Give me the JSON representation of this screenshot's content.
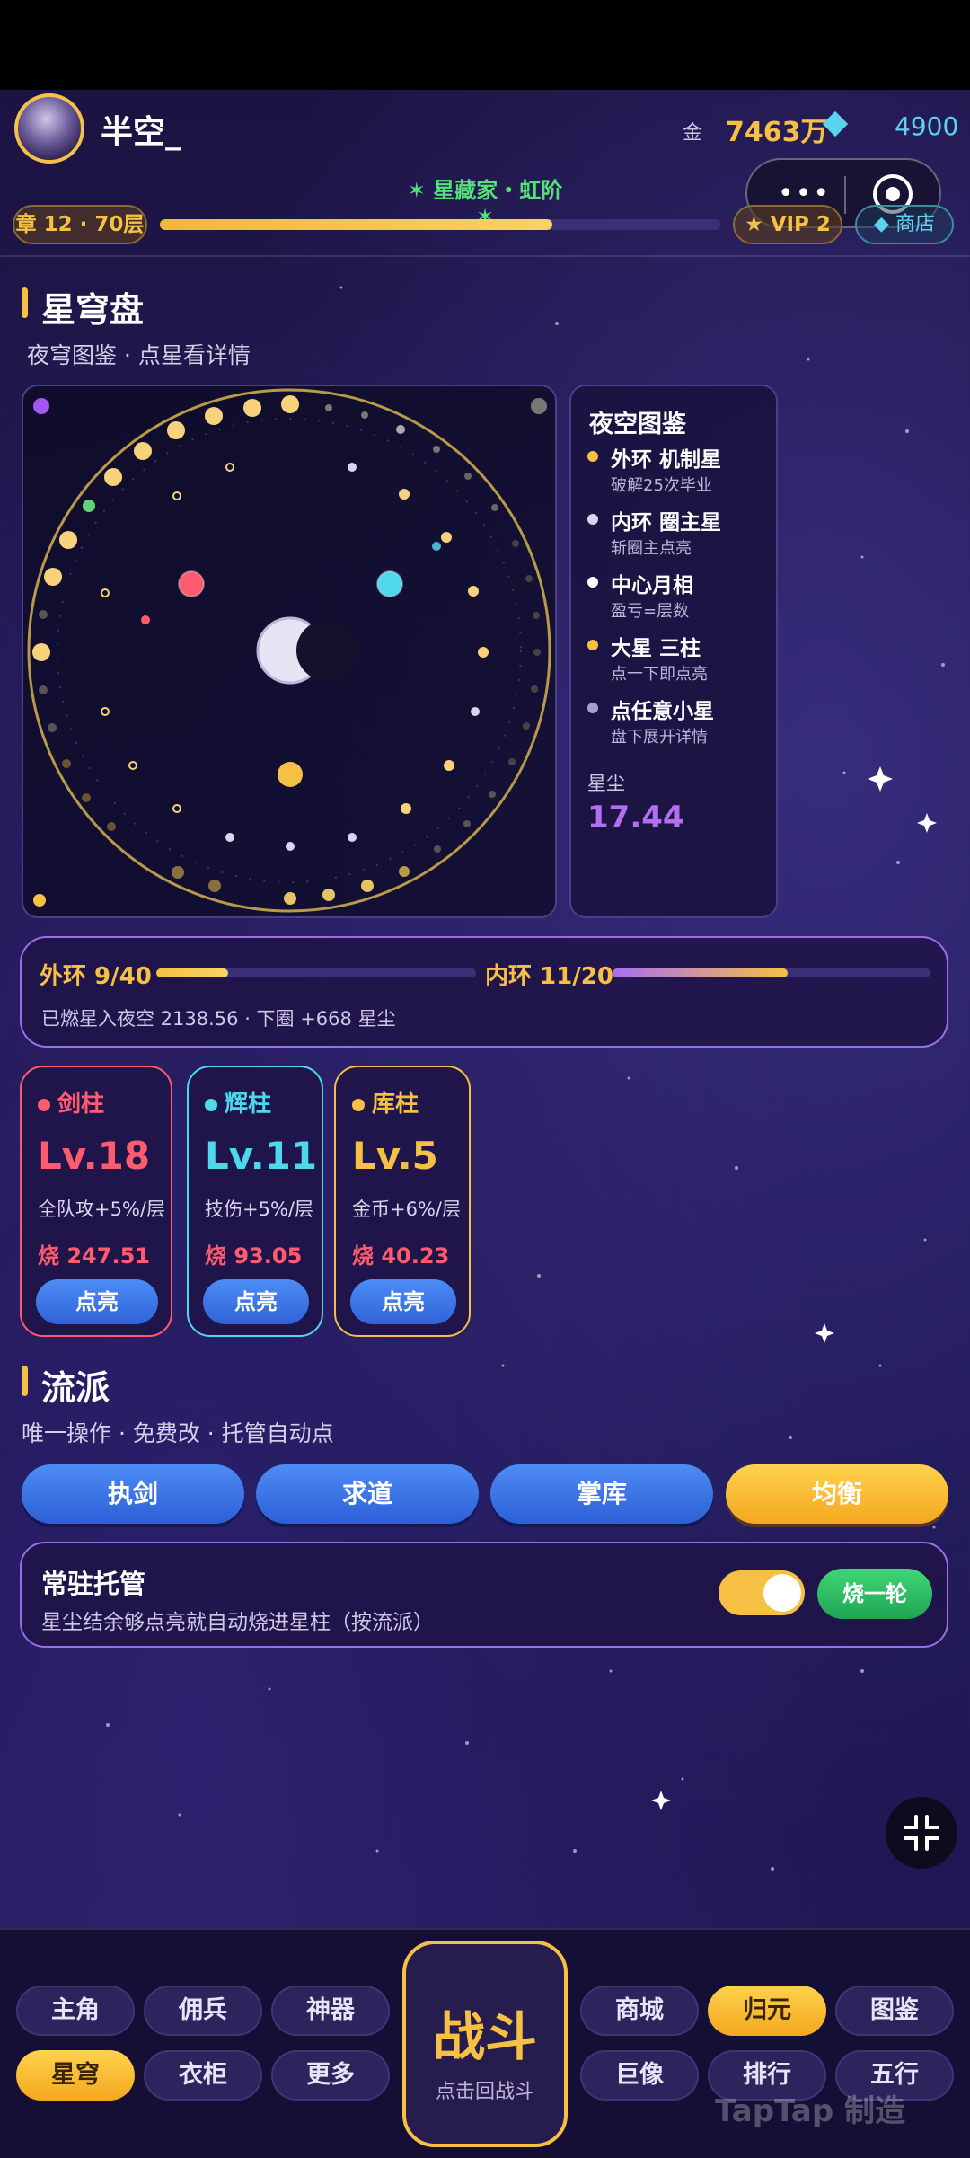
{
  "header": {
    "username": "半空_",
    "gold_label": "金",
    "gold_value": "7463万",
    "diamond_value": "4900",
    "title_tag": "✶ 星藏家・虹阶 ✶",
    "chapter": "章 12 · 70层",
    "level_progress": 0.7,
    "vip": "★ VIP 2",
    "shop": "◆ 商店"
  },
  "starplate": {
    "title": "星穹盘",
    "subtitle": "夜穹图鉴 · 点星看详情",
    "side_title": "夜空图鉴",
    "legend": [
      {
        "name": "外环 机制星",
        "desc": "破解25次毕业",
        "color": "#f5c044"
      },
      {
        "name": "内环 圈主星",
        "desc": "斩圈主点亮",
        "color": "#d9d4f0"
      },
      {
        "name": "中心月相",
        "desc": "盈亏=层数",
        "color": "#ffffff"
      },
      {
        "name": "大星 三柱",
        "desc": "点一下即点亮",
        "color": "#f5c044"
      },
      {
        "name": "点任意小星",
        "desc": "盘下展开详情",
        "color": "#a99fd0"
      }
    ],
    "dust_label": "星尘",
    "dust_value": "17.44"
  },
  "rings": {
    "outer_label": "外环 9/40",
    "outer_progress": 0.225,
    "inner_label": "内环 11/20",
    "inner_progress": 0.55,
    "footer": "已燃星入夜空 2138.56 · 下圈 +668 星尘"
  },
  "pillars": [
    {
      "name": "剑柱",
      "level": "Lv.18",
      "effect": "全队攻+5%/层",
      "burn": "烧 247.51",
      "button": "点亮",
      "color": "#ff5b6e"
    },
    {
      "name": "辉柱",
      "level": "Lv.11",
      "effect": "技伤+5%/层",
      "burn": "烧 93.05",
      "button": "点亮",
      "color": "#4fd8ec"
    },
    {
      "name": "库柱",
      "level": "Lv.5",
      "effect": "金币+6%/层",
      "burn": "烧 40.23",
      "button": "点亮",
      "color": "#f5c044"
    }
  ],
  "styles": {
    "title": "流派",
    "subtitle": "唯一操作 · 免费改 · 托管自动点",
    "options": [
      "执剑",
      "求道",
      "掌库",
      "均衡"
    ],
    "active": "均衡"
  },
  "auto": {
    "title": "常驻托管",
    "desc": "星尘结余够点亮就自动烧进星柱（按流派）",
    "toggle_on": true,
    "burn_button": "烧一轮"
  },
  "nav": {
    "left_row1": [
      "主角",
      "佣兵",
      "神器"
    ],
    "left_row2": [
      "星穹",
      "衣柜",
      "更多"
    ],
    "right_row1": [
      "商城",
      "归元",
      "图鉴"
    ],
    "right_row2": [
      "巨像",
      "排行",
      "五行"
    ],
    "battle_title": "战斗",
    "battle_sub": "点击回战斗",
    "watermark": "TapTap 制造"
  }
}
